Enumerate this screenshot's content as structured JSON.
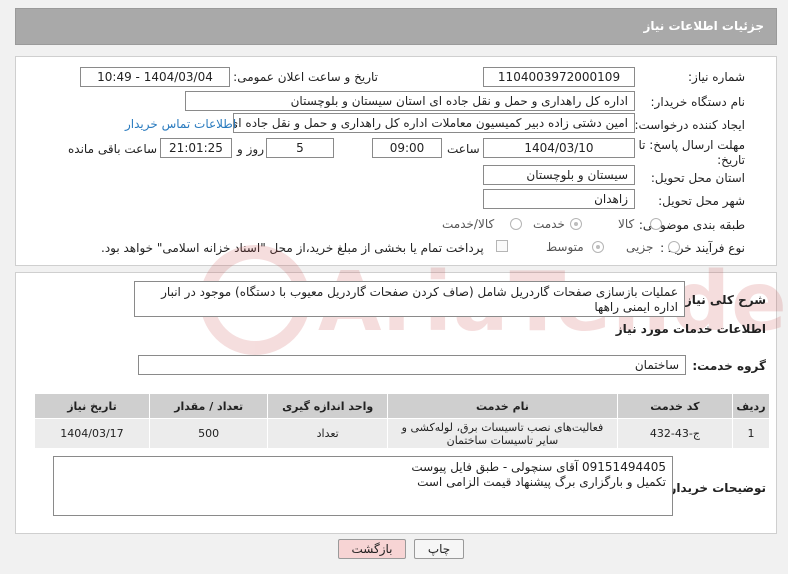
{
  "header": {
    "title": "جزئیات اطلاعات نیاز"
  },
  "form": {
    "need_number": {
      "label": "شماره نیاز:",
      "value": "1104003972000109"
    },
    "announce_datetime": {
      "label": "تاریخ و ساعت اعلان عمومی:",
      "value": "1404/03/04 - 10:49"
    },
    "buyer_org": {
      "label": "نام دستگاه خریدار:",
      "value": "اداره کل راهداری و حمل و نقل جاده ای استان سیستان و بلوچستان"
    },
    "requester": {
      "label": "ایجاد کننده درخواست:",
      "value": "امین دشتی زاده دبیر کمیسیون معاملات اداره کل راهداری و حمل و نقل جاده ای",
      "contact_link": "اطلاعات تماس خریدار"
    },
    "deadline": {
      "label": "مهلت ارسال پاسخ: تا تاریخ:",
      "date": "1404/03/10",
      "time_label": "ساعت",
      "time": "09:00",
      "days": "5",
      "days_label": "روز و",
      "remaining": "21:01:25",
      "remaining_label": "ساعت باقی مانده"
    },
    "province": {
      "label": "استان محل تحویل:",
      "value": "سیستان و بلوچستان"
    },
    "city": {
      "label": "شهر محل تحویل:",
      "value": "زاهدان"
    },
    "category": {
      "label": "طبقه بندی موضوعی:",
      "options": [
        "کالا",
        "خدمت",
        "کالا/خدمت"
      ],
      "selected": "خدمت"
    },
    "purchase_type": {
      "label": "نوع فرآیند خرید :",
      "options": [
        "جزیی",
        "متوسط"
      ],
      "selected": "متوسط",
      "note": "پرداخت تمام یا بخشی از مبلغ خرید،از محل \"اسناد خزانه اسلامی\" خواهد بود."
    }
  },
  "description": {
    "label": "شرح کلی نیاز:",
    "value": "عملیات بازسازی صفحات گاردریل شامل (صاف کردن صفحات گاردریل معیوب با دستگاه) موجود در انبار اداره ایمنی راهها"
  },
  "services": {
    "section_title": "اطلاعات خدمات مورد نیاز",
    "group_label": "گروه خدمت:",
    "group_value": "ساختمان",
    "columns": [
      "ردیف",
      "کد خدمت",
      "نام خدمت",
      "واحد اندازه گیری",
      "تعداد / مقدار",
      "تاریخ نیاز"
    ],
    "rows": [
      {
        "row": "1",
        "code": "ج-43-432",
        "name": "فعالیت‌های نصب تاسیسات برق، لوله‌کشی و سایر تاسیسات ساختمان",
        "unit": "تعداد",
        "qty": "500",
        "date": "1404/03/17"
      }
    ]
  },
  "buyer_notes": {
    "label": "توضیحات خریدار:",
    "line1": "09151494405 آقای سنچولی - طبق فایل پیوست",
    "line2": "تکمیل و بارگزاری برگ پیشنهاد قیمت الزامی است"
  },
  "buttons": {
    "print": "چاپ",
    "back": "بازگشت"
  },
  "watermark": {
    "text": "AriaTender.neT"
  },
  "colors": {
    "header_bg": "#a9a9a9",
    "link": "#2a7bbf",
    "back_button_bg": "#f7d4d4"
  }
}
